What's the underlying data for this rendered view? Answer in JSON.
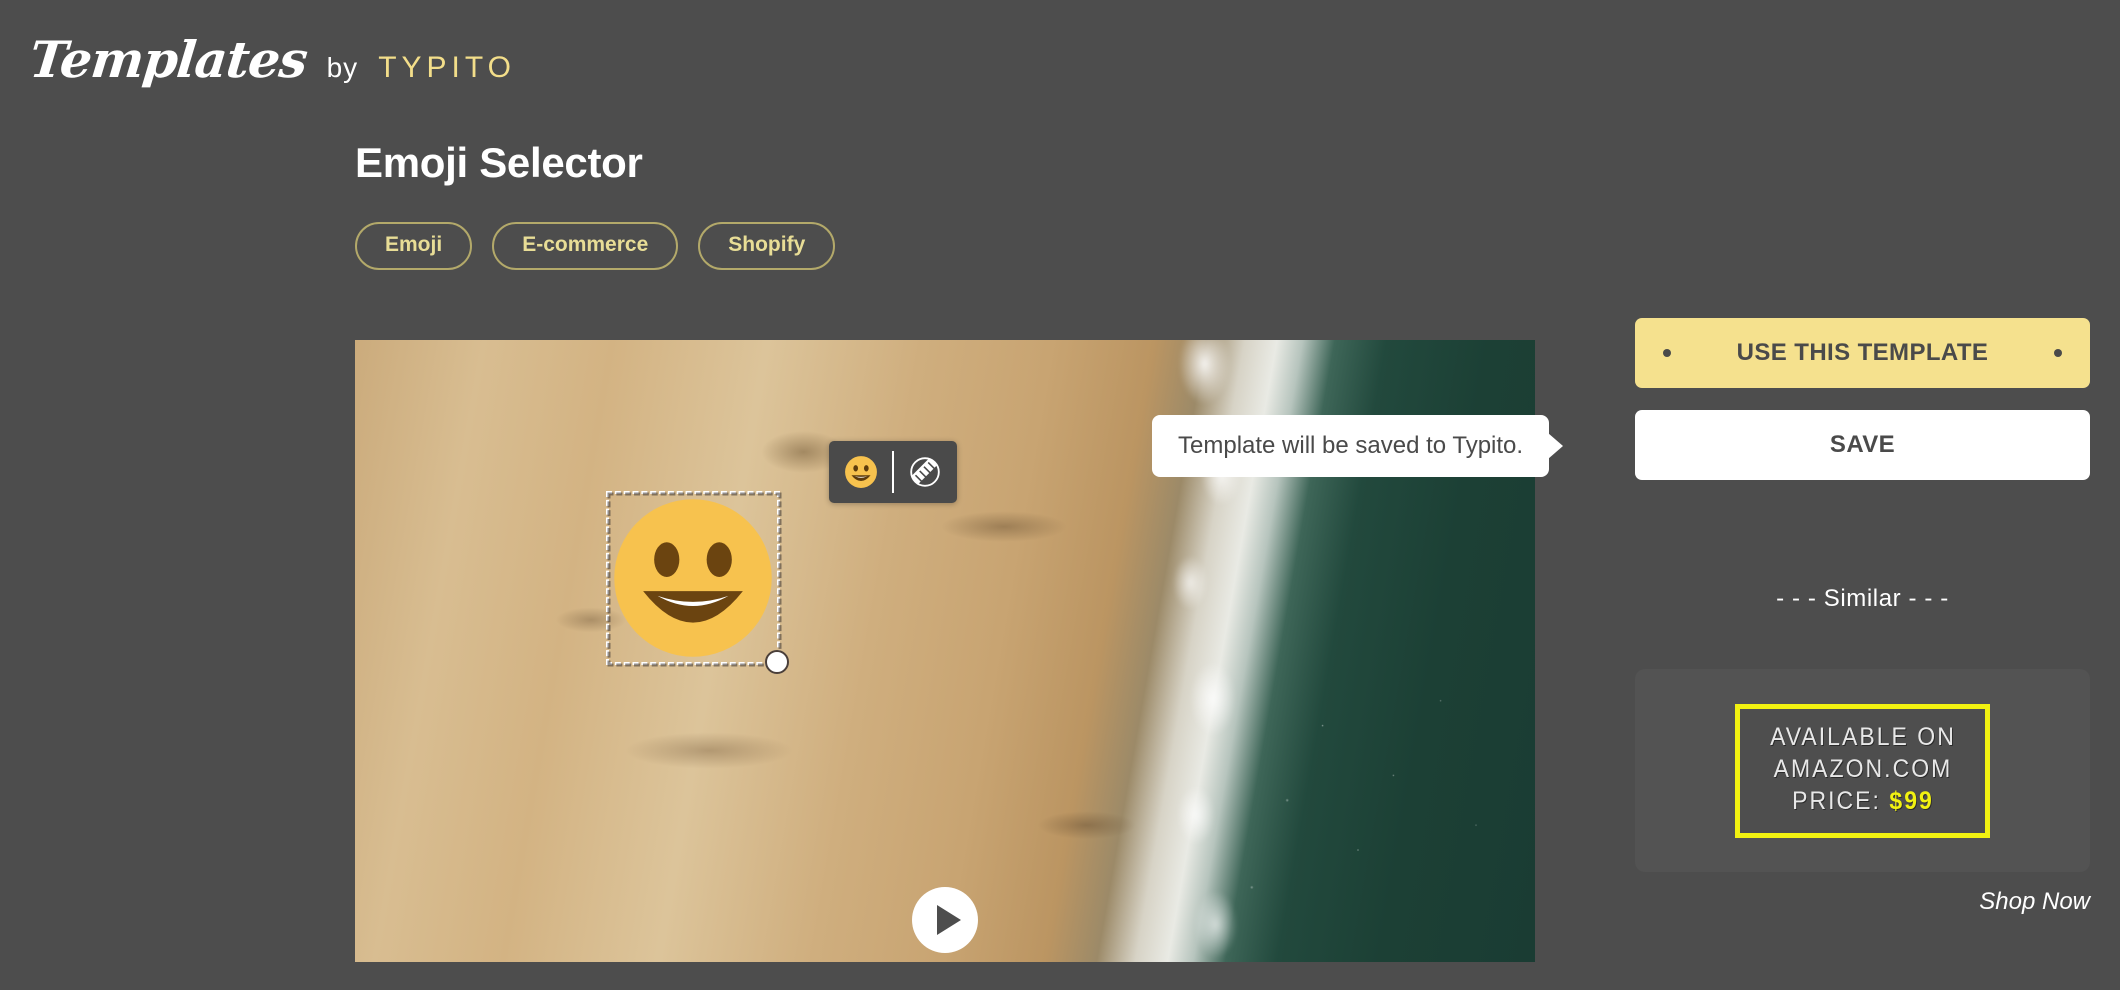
{
  "brand": {
    "logo_main": "Templates",
    "logo_by": "by",
    "logo_name": "TYPITO",
    "accent_color": "#f3de8a"
  },
  "template": {
    "title": "Emoji Selector",
    "tags": [
      {
        "label": "Emoji"
      },
      {
        "label": "E-commerce"
      },
      {
        "label": "Shopify"
      }
    ]
  },
  "editor": {
    "toolbar": {
      "emoji_icon": "emoji-smiley-icon",
      "opacity_icon": "opacity-hatched-circle-icon"
    },
    "selected_element": {
      "type": "emoji",
      "glyph": "grinning-face"
    },
    "play_label": "play"
  },
  "tooltip": {
    "text": "Template will be saved to Typito."
  },
  "actions": {
    "use_template_label": "USE THIS TEMPLATE",
    "save_label": "SAVE",
    "primary_color": "#f5e18e",
    "secondary_color": "#ffffff"
  },
  "similar": {
    "heading": "- - - Similar - - -",
    "card": {
      "line1": "AVAILABLE ON",
      "line2": "AMAZON.COM",
      "price_label": "PRICE:",
      "price_value": "$99",
      "border_color": "#f2f211"
    },
    "shop_now_label": "Shop Now"
  }
}
